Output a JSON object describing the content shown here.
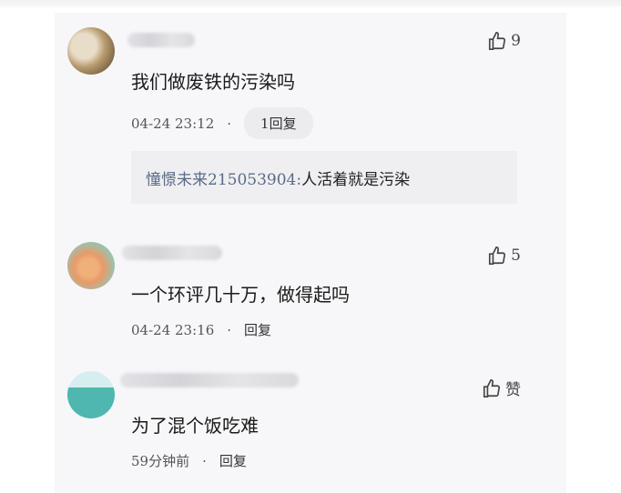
{
  "comments": [
    {
      "text": "我们做废铁的污染吗",
      "time": "04-24 23:12",
      "reply_label": "1回复",
      "likes": "9",
      "reply_quote": {
        "author": "憧憬未来215053904:",
        "text": "人活着就是污染"
      },
      "avatar_colors": [
        "#6b5a3b",
        "#b99b6f",
        "#e8ddc8"
      ]
    },
    {
      "text": "一个环评几十万，做得起吗",
      "time": "04-24 23:16",
      "reply_label": "回复",
      "likes": "5",
      "avatar_colors": [
        "#8fc9b8",
        "#f0b07a",
        "#e89a6a"
      ]
    },
    {
      "text": "为了混个饭吃难",
      "time": "59分钟前",
      "reply_label": "回复",
      "likes": "赞",
      "avatar_colors": [
        "#9fd3d8",
        "#4fb6b0",
        "#d7eef0"
      ]
    }
  ],
  "separator": "·"
}
